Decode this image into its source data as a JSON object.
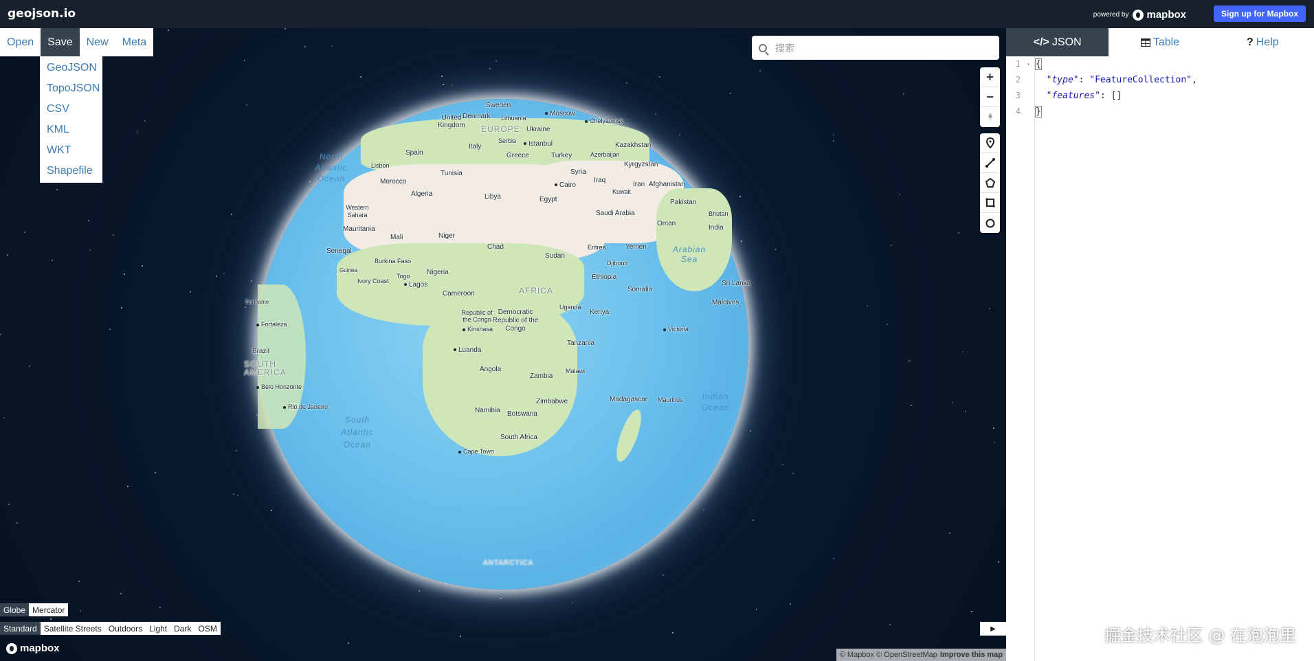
{
  "topbar": {
    "logo": "geojson.io",
    "powered_by": "powered by",
    "mapbox_brand": "mapbox",
    "signup_label": "Sign up for Mapbox"
  },
  "menu": {
    "items": [
      {
        "label": "Open",
        "active": false
      },
      {
        "label": "Save",
        "active": true
      },
      {
        "label": "New",
        "active": false
      },
      {
        "label": "Meta",
        "active": false
      }
    ],
    "save_submenu": [
      "GeoJSON",
      "TopoJSON",
      "CSV",
      "KML",
      "WKT",
      "Shapefile"
    ]
  },
  "search": {
    "placeholder": "搜索"
  },
  "map_labels": {
    "countries": [
      "Sweden",
      "United Kingdom",
      "Denmark",
      "Lithuania",
      "Moscow",
      "Chelyabinsk",
      "EUROPE",
      "Ukraine",
      "Kazakhstan",
      "Italy",
      "Serbia",
      "Istanbul",
      "Greece",
      "Turkey",
      "Azerbaijan",
      "Kyrgyzstan",
      "Spain",
      "Lisbon",
      "Tunisia",
      "Syria",
      "Iraq",
      "Iran",
      "Afghanistan",
      "Morocco",
      "Cairo",
      "Kuwait",
      "Pakistan",
      "Algeria",
      "Libya",
      "Egypt",
      "Saudi Arabia",
      "Bhutan",
      "Western Sahara",
      "India",
      "Oman",
      "Mauritania",
      "Mali",
      "Niger",
      "Chad",
      "Sudan",
      "Eritrea",
      "Yemen",
      "Senegal",
      "Burkina Faso",
      "Guinea",
      "Djibouti",
      "Ivory Coast",
      "Togo",
      "Nigeria",
      "Ethiopia",
      "Sri Lanka",
      "Lagos",
      "Cameroon",
      "AFRICA",
      "Somalia",
      "Maldives",
      "Suriname",
      "Republic of the Congo",
      "Democratic Republic of the Congo",
      "Uganda",
      "Kenya",
      "Fortaleza",
      "Kinshasa",
      "Victoria",
      "Brazil",
      "Luanda",
      "Tanzania",
      "SOUTH AMERICA",
      "Angola",
      "Zambia",
      "Malawi",
      "Belo Horizonte",
      "Madagascar",
      "Mauritius",
      "Zimbabwe",
      "Rio de Janeiro",
      "Namibia",
      "Botswana",
      "South Africa",
      "Cape Town",
      "ANTARCTICA"
    ],
    "seas": [
      "North Atlantic Ocean",
      "Arabian Sea",
      "Indian Ocean",
      "South Atlantic Ocean"
    ]
  },
  "map_controls": {
    "zoom_in": "+",
    "zoom_out": "−"
  },
  "projection": {
    "options": [
      {
        "label": "Globe",
        "active": true
      },
      {
        "label": "Mercator",
        "active": false
      }
    ]
  },
  "styles": {
    "options": [
      {
        "label": "Standard",
        "active": true
      },
      {
        "label": "Satellite Streets",
        "active": false
      },
      {
        "label": "Outdoors",
        "active": false
      },
      {
        "label": "Light",
        "active": false
      },
      {
        "label": "Dark",
        "active": false
      },
      {
        "label": "OSM",
        "active": false
      }
    ]
  },
  "map_footer": {
    "logo": "mapbox",
    "attribution": "© Mapbox © OpenStreetMap",
    "improve": "Improve this map"
  },
  "panel": {
    "tabs": [
      {
        "label": "JSON",
        "icon": "code-icon",
        "active": true
      },
      {
        "label": "Table",
        "icon": "table-icon",
        "active": false
      },
      {
        "label": "Help",
        "icon": "question-icon",
        "active": false
      }
    ],
    "editor": {
      "line_numbers": [
        "1",
        "2",
        "3",
        "4"
      ],
      "lines": {
        "l1": "{",
        "l2_key": "\"type\"",
        "l2_val": "\"FeatureCollection\"",
        "l3_key": "\"features\"",
        "l3_val": "[]",
        "l4": "}"
      }
    }
  },
  "watermark": "掘金技术社区 @ 在泡泡里",
  "colors": {
    "topbar": "#16212b",
    "accent": "#3f7cb6",
    "active_bg": "#36434f",
    "signup": "#4264fb"
  }
}
